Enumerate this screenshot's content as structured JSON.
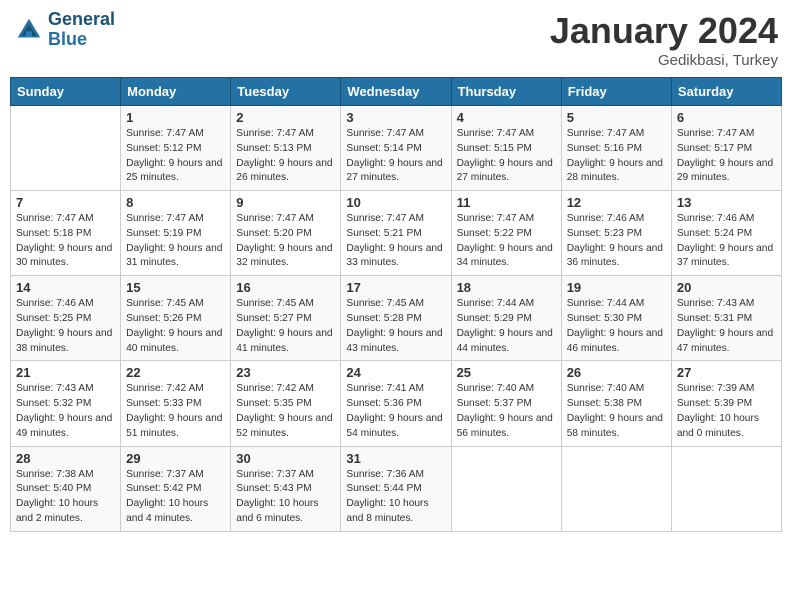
{
  "header": {
    "logo_line1": "General",
    "logo_line2": "Blue",
    "month": "January 2024",
    "location": "Gedikbasi, Turkey"
  },
  "days_of_week": [
    "Sunday",
    "Monday",
    "Tuesday",
    "Wednesday",
    "Thursday",
    "Friday",
    "Saturday"
  ],
  "weeks": [
    [
      {
        "day": "",
        "sunrise": "",
        "sunset": "",
        "daylight": ""
      },
      {
        "day": "1",
        "sunrise": "Sunrise: 7:47 AM",
        "sunset": "Sunset: 5:12 PM",
        "daylight": "Daylight: 9 hours and 25 minutes."
      },
      {
        "day": "2",
        "sunrise": "Sunrise: 7:47 AM",
        "sunset": "Sunset: 5:13 PM",
        "daylight": "Daylight: 9 hours and 26 minutes."
      },
      {
        "day": "3",
        "sunrise": "Sunrise: 7:47 AM",
        "sunset": "Sunset: 5:14 PM",
        "daylight": "Daylight: 9 hours and 27 minutes."
      },
      {
        "day": "4",
        "sunrise": "Sunrise: 7:47 AM",
        "sunset": "Sunset: 5:15 PM",
        "daylight": "Daylight: 9 hours and 27 minutes."
      },
      {
        "day": "5",
        "sunrise": "Sunrise: 7:47 AM",
        "sunset": "Sunset: 5:16 PM",
        "daylight": "Daylight: 9 hours and 28 minutes."
      },
      {
        "day": "6",
        "sunrise": "Sunrise: 7:47 AM",
        "sunset": "Sunset: 5:17 PM",
        "daylight": "Daylight: 9 hours and 29 minutes."
      }
    ],
    [
      {
        "day": "7",
        "sunrise": "Sunrise: 7:47 AM",
        "sunset": "Sunset: 5:18 PM",
        "daylight": "Daylight: 9 hours and 30 minutes."
      },
      {
        "day": "8",
        "sunrise": "Sunrise: 7:47 AM",
        "sunset": "Sunset: 5:19 PM",
        "daylight": "Daylight: 9 hours and 31 minutes."
      },
      {
        "day": "9",
        "sunrise": "Sunrise: 7:47 AM",
        "sunset": "Sunset: 5:20 PM",
        "daylight": "Daylight: 9 hours and 32 minutes."
      },
      {
        "day": "10",
        "sunrise": "Sunrise: 7:47 AM",
        "sunset": "Sunset: 5:21 PM",
        "daylight": "Daylight: 9 hours and 33 minutes."
      },
      {
        "day": "11",
        "sunrise": "Sunrise: 7:47 AM",
        "sunset": "Sunset: 5:22 PM",
        "daylight": "Daylight: 9 hours and 34 minutes."
      },
      {
        "day": "12",
        "sunrise": "Sunrise: 7:46 AM",
        "sunset": "Sunset: 5:23 PM",
        "daylight": "Daylight: 9 hours and 36 minutes."
      },
      {
        "day": "13",
        "sunrise": "Sunrise: 7:46 AM",
        "sunset": "Sunset: 5:24 PM",
        "daylight": "Daylight: 9 hours and 37 minutes."
      }
    ],
    [
      {
        "day": "14",
        "sunrise": "Sunrise: 7:46 AM",
        "sunset": "Sunset: 5:25 PM",
        "daylight": "Daylight: 9 hours and 38 minutes."
      },
      {
        "day": "15",
        "sunrise": "Sunrise: 7:45 AM",
        "sunset": "Sunset: 5:26 PM",
        "daylight": "Daylight: 9 hours and 40 minutes."
      },
      {
        "day": "16",
        "sunrise": "Sunrise: 7:45 AM",
        "sunset": "Sunset: 5:27 PM",
        "daylight": "Daylight: 9 hours and 41 minutes."
      },
      {
        "day": "17",
        "sunrise": "Sunrise: 7:45 AM",
        "sunset": "Sunset: 5:28 PM",
        "daylight": "Daylight: 9 hours and 43 minutes."
      },
      {
        "day": "18",
        "sunrise": "Sunrise: 7:44 AM",
        "sunset": "Sunset: 5:29 PM",
        "daylight": "Daylight: 9 hours and 44 minutes."
      },
      {
        "day": "19",
        "sunrise": "Sunrise: 7:44 AM",
        "sunset": "Sunset: 5:30 PM",
        "daylight": "Daylight: 9 hours and 46 minutes."
      },
      {
        "day": "20",
        "sunrise": "Sunrise: 7:43 AM",
        "sunset": "Sunset: 5:31 PM",
        "daylight": "Daylight: 9 hours and 47 minutes."
      }
    ],
    [
      {
        "day": "21",
        "sunrise": "Sunrise: 7:43 AM",
        "sunset": "Sunset: 5:32 PM",
        "daylight": "Daylight: 9 hours and 49 minutes."
      },
      {
        "day": "22",
        "sunrise": "Sunrise: 7:42 AM",
        "sunset": "Sunset: 5:33 PM",
        "daylight": "Daylight: 9 hours and 51 minutes."
      },
      {
        "day": "23",
        "sunrise": "Sunrise: 7:42 AM",
        "sunset": "Sunset: 5:35 PM",
        "daylight": "Daylight: 9 hours and 52 minutes."
      },
      {
        "day": "24",
        "sunrise": "Sunrise: 7:41 AM",
        "sunset": "Sunset: 5:36 PM",
        "daylight": "Daylight: 9 hours and 54 minutes."
      },
      {
        "day": "25",
        "sunrise": "Sunrise: 7:40 AM",
        "sunset": "Sunset: 5:37 PM",
        "daylight": "Daylight: 9 hours and 56 minutes."
      },
      {
        "day": "26",
        "sunrise": "Sunrise: 7:40 AM",
        "sunset": "Sunset: 5:38 PM",
        "daylight": "Daylight: 9 hours and 58 minutes."
      },
      {
        "day": "27",
        "sunrise": "Sunrise: 7:39 AM",
        "sunset": "Sunset: 5:39 PM",
        "daylight": "Daylight: 10 hours and 0 minutes."
      }
    ],
    [
      {
        "day": "28",
        "sunrise": "Sunrise: 7:38 AM",
        "sunset": "Sunset: 5:40 PM",
        "daylight": "Daylight: 10 hours and 2 minutes."
      },
      {
        "day": "29",
        "sunrise": "Sunrise: 7:37 AM",
        "sunset": "Sunset: 5:42 PM",
        "daylight": "Daylight: 10 hours and 4 minutes."
      },
      {
        "day": "30",
        "sunrise": "Sunrise: 7:37 AM",
        "sunset": "Sunset: 5:43 PM",
        "daylight": "Daylight: 10 hours and 6 minutes."
      },
      {
        "day": "31",
        "sunrise": "Sunrise: 7:36 AM",
        "sunset": "Sunset: 5:44 PM",
        "daylight": "Daylight: 10 hours and 8 minutes."
      },
      {
        "day": "",
        "sunrise": "",
        "sunset": "",
        "daylight": ""
      },
      {
        "day": "",
        "sunrise": "",
        "sunset": "",
        "daylight": ""
      },
      {
        "day": "",
        "sunrise": "",
        "sunset": "",
        "daylight": ""
      }
    ]
  ]
}
